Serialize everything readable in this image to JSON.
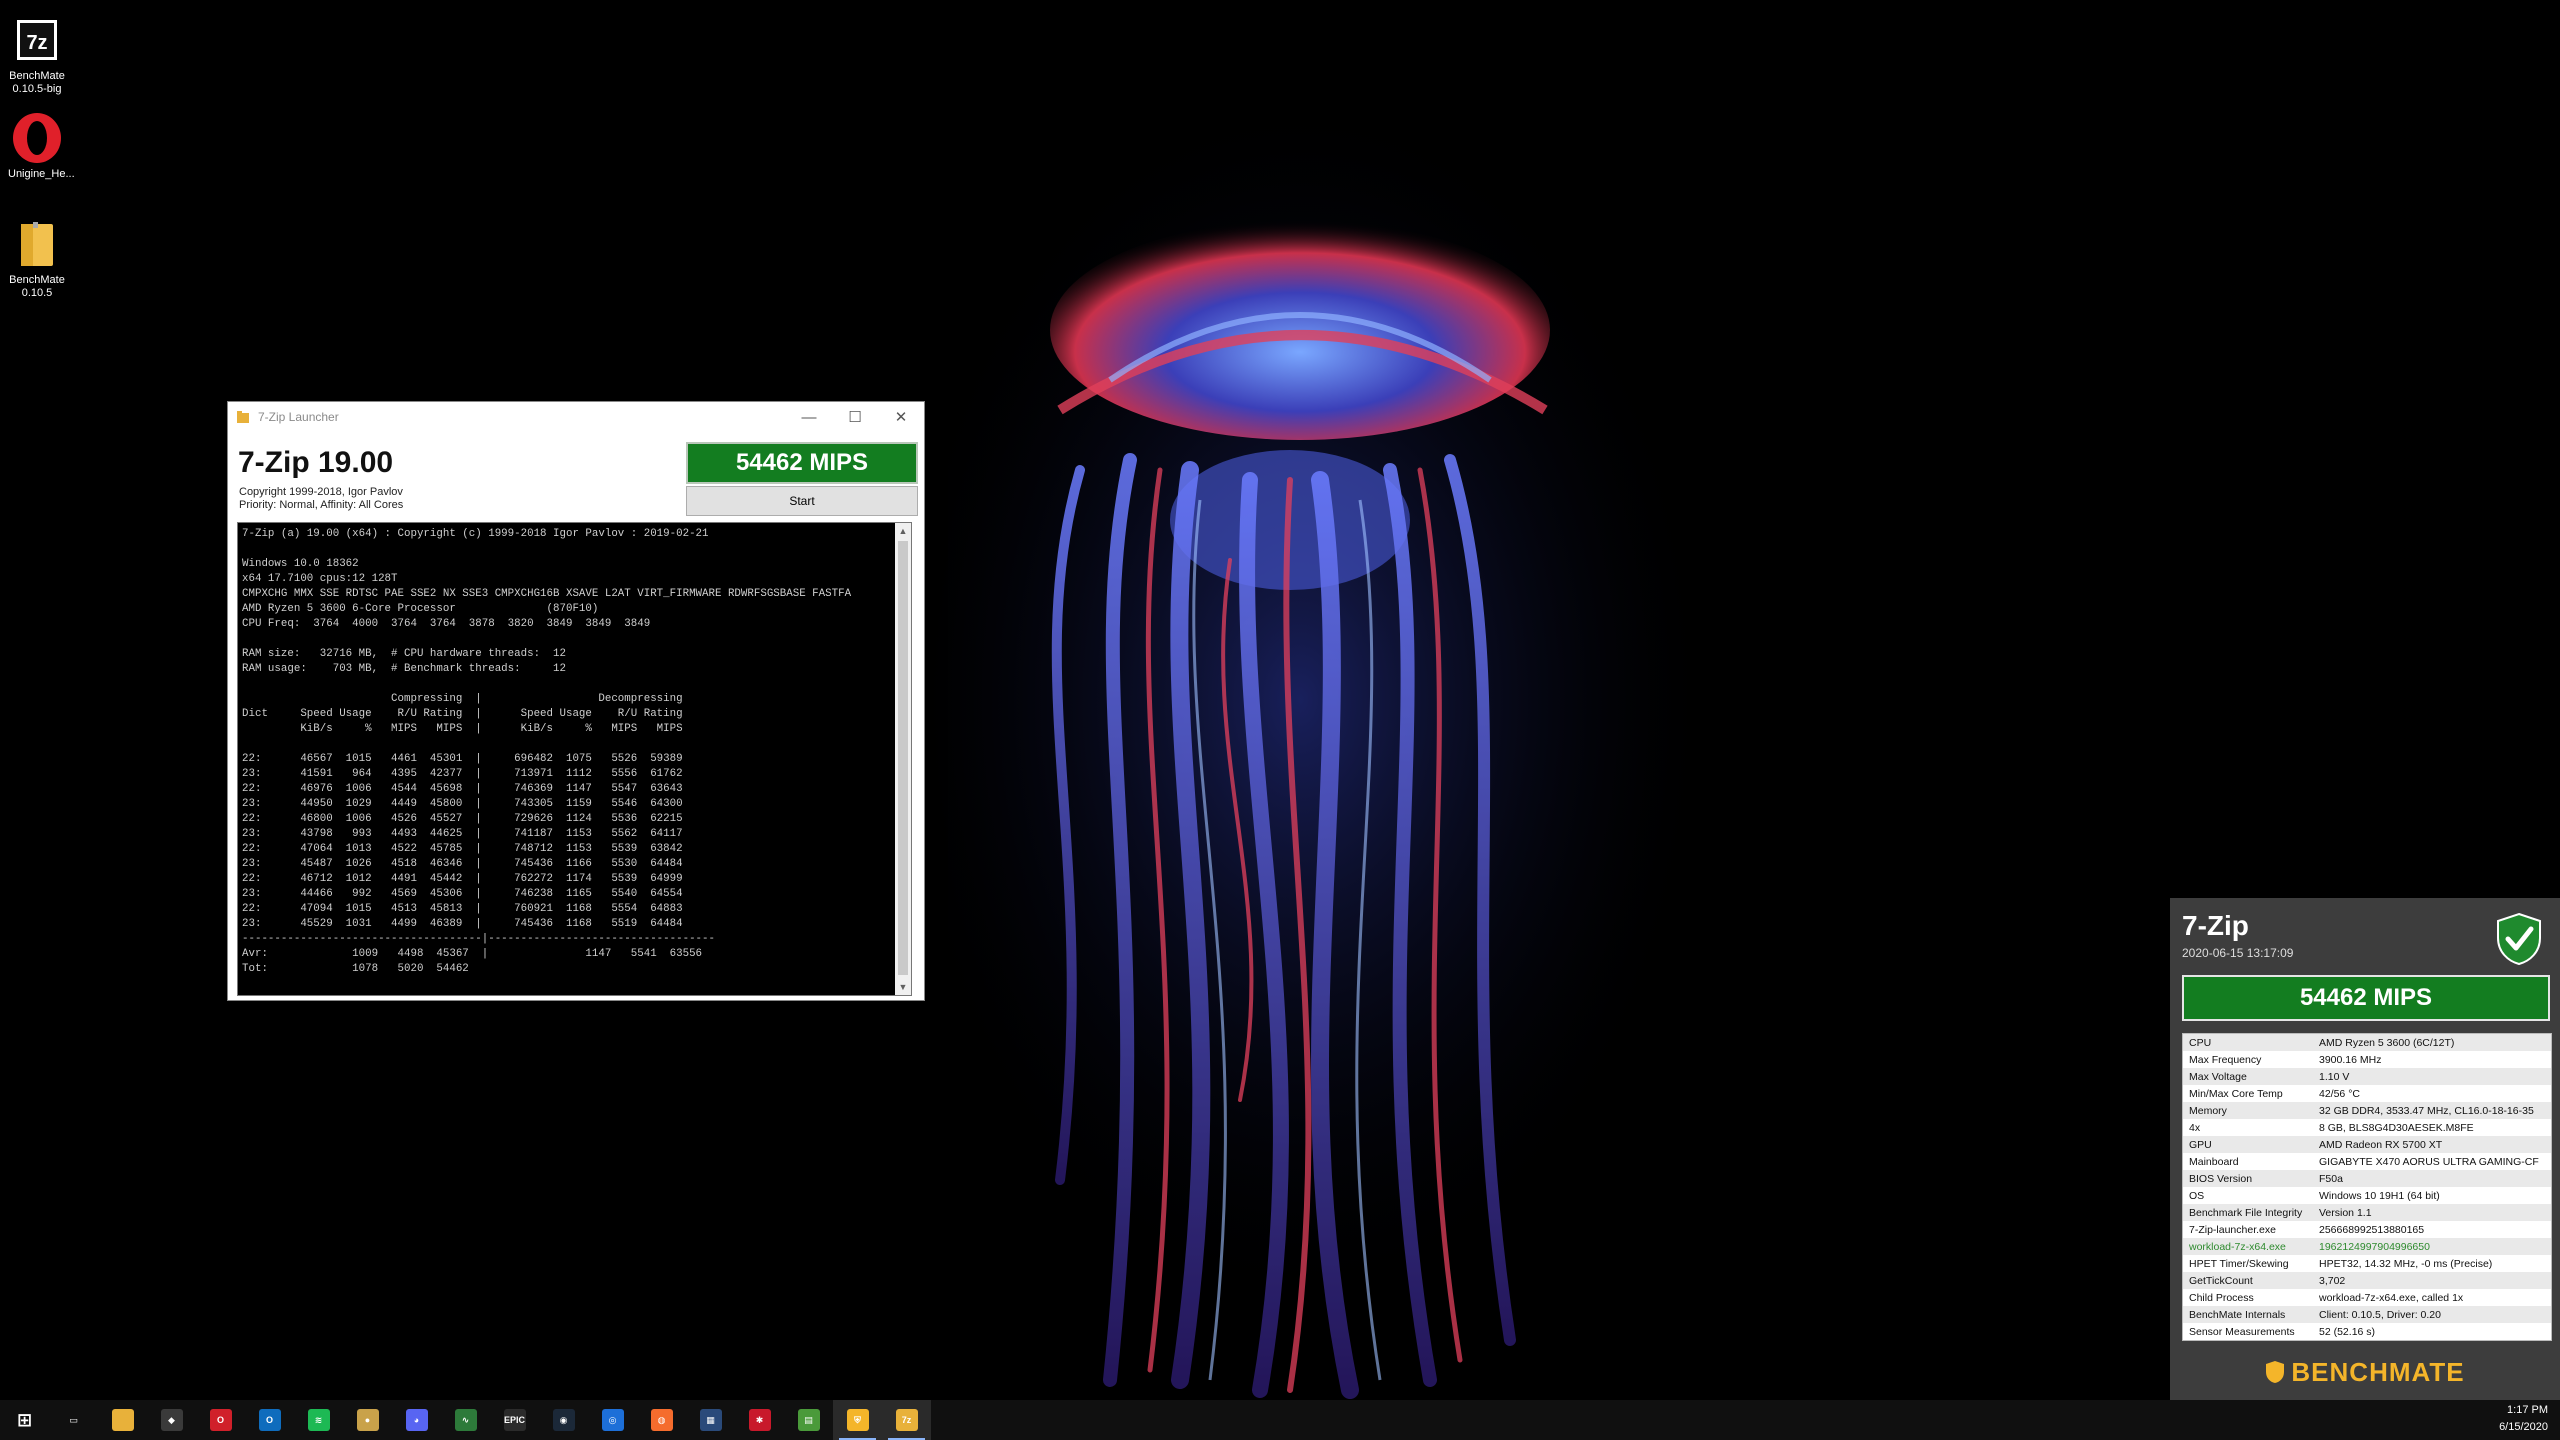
{
  "desktop": {
    "icons": [
      {
        "label": "BenchMate 0.10.5-big",
        "icon": "sevenzip-icon"
      },
      {
        "label": "Unigine_He...",
        "icon": "opera-icon"
      },
      {
        "label": "BenchMate 0.10.5",
        "icon": "folder-icon"
      }
    ]
  },
  "launcher": {
    "window_title": "7-Zip Launcher",
    "app_title": "7-Zip 19.00",
    "copyright": "Copyright 1999-2018, Igor Pavlov",
    "priority": "Priority: Normal, Affinity: All Cores",
    "score": "54462 MIPS",
    "start_label": "Start",
    "console_lines": [
      "7-Zip (a) 19.00 (x64) : Copyright (c) 1999-2018 Igor Pavlov : 2019-02-21",
      "",
      "Windows 10.0 18362",
      "x64 17.7100 cpus:12 128T",
      "CMPXCHG MMX SSE RDTSC PAE SSE2 NX SSE3 CMPXCHG16B XSAVE L2AT VIRT_FIRMWARE RDWRFSGSBASE FASTFA",
      "AMD Ryzen 5 3600 6-Core Processor              (870F10)",
      "CPU Freq:  3764  4000  3764  3764  3878  3820  3849  3849  3849",
      "",
      "RAM size:   32716 MB,  # CPU hardware threads:  12",
      "RAM usage:    703 MB,  # Benchmark threads:     12",
      "",
      "                       Compressing  |                  Decompressing",
      "Dict     Speed Usage    R/U Rating  |      Speed Usage    R/U Rating",
      "         KiB/s     %   MIPS   MIPS  |      KiB/s     %   MIPS   MIPS",
      "",
      "22:      46567  1015   4461  45301  |     696482  1075   5526  59389",
      "23:      41591   964   4395  42377  |     713971  1112   5556  61762",
      "22:      46976  1006   4544  45698  |     746369  1147   5547  63643",
      "23:      44950  1029   4449  45800  |     743305  1159   5546  64300",
      "22:      46800  1006   4526  45527  |     729626  1124   5536  62215",
      "23:      43798   993   4493  44625  |     741187  1153   5562  64117",
      "22:      47064  1013   4522  45785  |     748712  1153   5539  63842",
      "23:      45487  1026   4518  46346  |     745436  1166   5530  64484",
      "22:      46712  1012   4491  45442  |     762272  1174   5539  64999",
      "23:      44466   992   4569  45306  |     746238  1165   5540  64554",
      "22:      47094  1015   4513  45813  |     760921  1168   5554  64883",
      "23:      45529  1031   4499  46389  |     745436  1168   5519  64484",
      "-------------------------------------|-----------------------------------",
      "Avr:             1009   4498  45367  |               1147   5541  63556",
      "Tot:             1078   5020  54462"
    ]
  },
  "benchmate": {
    "title": "7-Zip",
    "datetime": "2020-06-15 13:17:09",
    "score": "54462 MIPS",
    "rows": [
      {
        "k": "CPU",
        "v": "AMD Ryzen 5 3600 (6C/12T)"
      },
      {
        "k": "Max Frequency",
        "v": "3900.16 MHz"
      },
      {
        "k": "Max Voltage",
        "v": "1.10 V"
      },
      {
        "k": "Min/Max Core Temp",
        "v": "42/56 °C"
      },
      {
        "k": "Memory",
        "v": "32 GB DDR4, 3533.47 MHz, CL16.0-18-16-35"
      },
      {
        "k": "4x",
        "v": "8 GB, BLS8G4D30AESEK.M8FE"
      },
      {
        "k": "GPU",
        "v": "AMD Radeon RX 5700 XT"
      },
      {
        "k": "Mainboard",
        "v": "GIGABYTE X470 AORUS ULTRA GAMING-CF"
      },
      {
        "k": "BIOS Version",
        "v": "F50a"
      },
      {
        "k": "OS",
        "v": "Windows 10 19H1 (64 bit)"
      },
      {
        "k": "Benchmark File Integrity",
        "v": "Version 1.1"
      },
      {
        "k": "7-Zip-launcher.exe",
        "v": "2566689925138801​65"
      },
      {
        "k": "workload-7z-x64.exe",
        "v": "1962124997904996650",
        "accent": true
      },
      {
        "k": "HPET Timer/Skewing",
        "v": "HPET32, 14.32 MHz, -0 ms (Precise)"
      },
      {
        "k": "GetTickCount",
        "v": "3,702"
      },
      {
        "k": "Child Process",
        "v": "workload-7z-x64.exe, called 1x"
      },
      {
        "k": "BenchMate Internals",
        "v": "Client: 0.10.5, Driver: 0.20"
      },
      {
        "k": "Sensor Measurements",
        "v": "52 (52.16 s)"
      }
    ],
    "brand": "BENCHMATE"
  },
  "taskbar": {
    "items": [
      {
        "name": "start-icon",
        "color": "#101010",
        "glyph": "⊞"
      },
      {
        "name": "task-view-icon",
        "color": "#101010",
        "glyph": "▭"
      },
      {
        "name": "file-explorer-icon",
        "color": "#e8b13a",
        "glyph": ""
      },
      {
        "name": "controller-app-icon",
        "color": "#3a3a3a",
        "glyph": "◆"
      },
      {
        "name": "opera-icon",
        "color": "#d0202a",
        "glyph": "O"
      },
      {
        "name": "outlook-icon",
        "color": "#0f6cbd",
        "glyph": "O"
      },
      {
        "name": "spotify-icon",
        "color": "#1db954",
        "glyph": "≋"
      },
      {
        "name": "joystick-app-icon",
        "color": "#c9a24a",
        "glyph": "●"
      },
      {
        "name": "discord-icon",
        "color": "#5865f2",
        "glyph": "◕"
      },
      {
        "name": "monitor-app-icon",
        "color": "#2d7a3a",
        "glyph": "∿"
      },
      {
        "name": "epic-games-icon",
        "color": "#2b2b2b",
        "glyph": "EPIC"
      },
      {
        "name": "steam-icon",
        "color": "#1b2838",
        "glyph": "◉"
      },
      {
        "name": "uplay-icon",
        "color": "#1d6fd8",
        "glyph": "◎"
      },
      {
        "name": "origin-icon",
        "color": "#f56c2d",
        "glyph": "◍"
      },
      {
        "name": "cpu-tool-icon",
        "color": "#2a4a7a",
        "glyph": "▦"
      },
      {
        "name": "bugs-app-icon",
        "color": "#c8192b",
        "glyph": "✱"
      },
      {
        "name": "gpu-tool-icon",
        "color": "#4a9a3a",
        "glyph": "▤"
      },
      {
        "name": "benchmate-icon",
        "color": "#f4b52a",
        "glyph": "⛨",
        "active": true
      },
      {
        "name": "launcher-icon",
        "color": "#e8b13a",
        "glyph": "7z",
        "active": true
      }
    ],
    "time": "1:17 PM",
    "date": "6/15/2020"
  }
}
